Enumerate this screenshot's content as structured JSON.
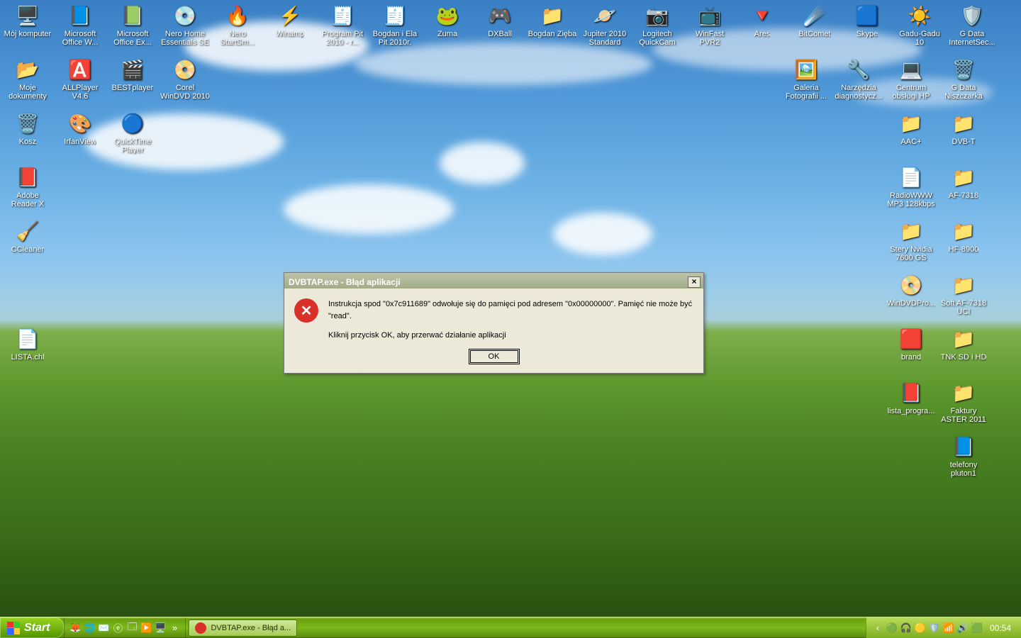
{
  "dialog": {
    "title": "DVBTAP.exe - Błąd aplikacji",
    "line1": "Instrukcja spod \"0x7c911689\" odwołuje się do pamięci pod adresem \"0x00000000\". Pamięć nie może być \"read\".",
    "line2": "Kliknij przycisk OK, aby przerwać działanie aplikacji",
    "ok": "OK"
  },
  "taskbar": {
    "start": "Start",
    "task1": "DVBTAP.exe - Błąd a...",
    "clock": "00:54"
  },
  "icons": {
    "r0": [
      {
        "l": "Mój komputer",
        "g": "🖥️"
      },
      {
        "l": "Microsoft Office W...",
        "g": "📘"
      },
      {
        "l": "Microsoft Office Ex...",
        "g": "📗"
      },
      {
        "l": "Nero Home Essentials SE",
        "g": "💿"
      },
      {
        "l": "Nero StartSm...",
        "g": "🔥"
      },
      {
        "l": "Winamp",
        "g": "⚡"
      },
      {
        "l": "Program Pit 2010 - r...",
        "g": "🧾"
      },
      {
        "l": "Bogdan i Ela Pit 2010r.",
        "g": "🧾"
      },
      {
        "l": "Zuma",
        "g": "🐸"
      },
      {
        "l": "DXBall",
        "g": "🎮"
      },
      {
        "l": "Bogdan Zięba",
        "g": "📁"
      },
      {
        "l": "Jupiter 2010 Standard",
        "g": "🪐"
      },
      {
        "l": "Logitech QuickCam",
        "g": "📷"
      },
      {
        "l": "WinFast PVR2",
        "g": "📺"
      },
      {
        "l": "Ares",
        "g": "🔻"
      },
      {
        "l": "BitComet",
        "g": "☄️"
      },
      {
        "l": "Skype",
        "g": "🟦"
      },
      {
        "l": "Gadu-Gadu 10",
        "g": "☀️"
      },
      {
        "l": "G Data InternetSec...",
        "g": "🛡️"
      }
    ],
    "r1": [
      {
        "l": "Moje dokumenty",
        "g": "📂"
      },
      {
        "l": "ALLPlayer V4.6",
        "g": "🅰️"
      },
      {
        "l": "BESTplayer",
        "g": "🎬"
      },
      {
        "l": "Corel WinDVD 2010",
        "g": "📀"
      }
    ],
    "r2": [
      {
        "l": "Kosz",
        "g": "🗑️"
      },
      {
        "l": "IrfanView",
        "g": "🎨"
      },
      {
        "l": "QuickTime Player",
        "g": "🔵"
      }
    ],
    "r3": [
      {
        "l": "Adobe Reader X",
        "g": "📕"
      }
    ],
    "r4": [
      {
        "l": "CCleaner",
        "g": "🧹"
      }
    ],
    "r6": [
      {
        "l": "LISTA.chl",
        "g": "📄"
      }
    ],
    "right": [
      [
        {
          "l": "Galeria Fotografii ...",
          "g": "🖼️"
        },
        {
          "l": "Narzędzia diagnostycz...",
          "g": "🔧"
        },
        {
          "l": "Centrum obsługi HP",
          "g": "💻"
        },
        {
          "l": "G Data Niszczarka",
          "g": "🗑️"
        }
      ],
      [
        {
          "l": "AAC+",
          "g": "📁"
        },
        {
          "l": "DVB-T",
          "g": "📁"
        }
      ],
      [
        {
          "l": "RadioWWW MP3 128kbps",
          "g": "📄"
        },
        {
          "l": "AF-7318",
          "g": "📁"
        }
      ],
      [
        {
          "l": "Stery Nvidia 7600 GS",
          "g": "📁"
        },
        {
          "l": "HF-8900",
          "g": "📁"
        }
      ],
      [
        {
          "l": "WinDVDPro...",
          "g": "📀"
        },
        {
          "l": "Soft AF-7318 UCI",
          "g": "📁"
        }
      ],
      [
        {
          "l": "brand",
          "g": "🟥"
        },
        {
          "l": "TNK SD i HD",
          "g": "📁"
        }
      ],
      [
        {
          "l": "lista_progra...",
          "g": "📕"
        },
        {
          "l": "Faktury ASTER 2011",
          "g": "📁"
        }
      ],
      [
        {
          "l": "",
          "g": ""
        },
        {
          "l": "telefony pluton1",
          "g": "📘"
        }
      ]
    ]
  }
}
